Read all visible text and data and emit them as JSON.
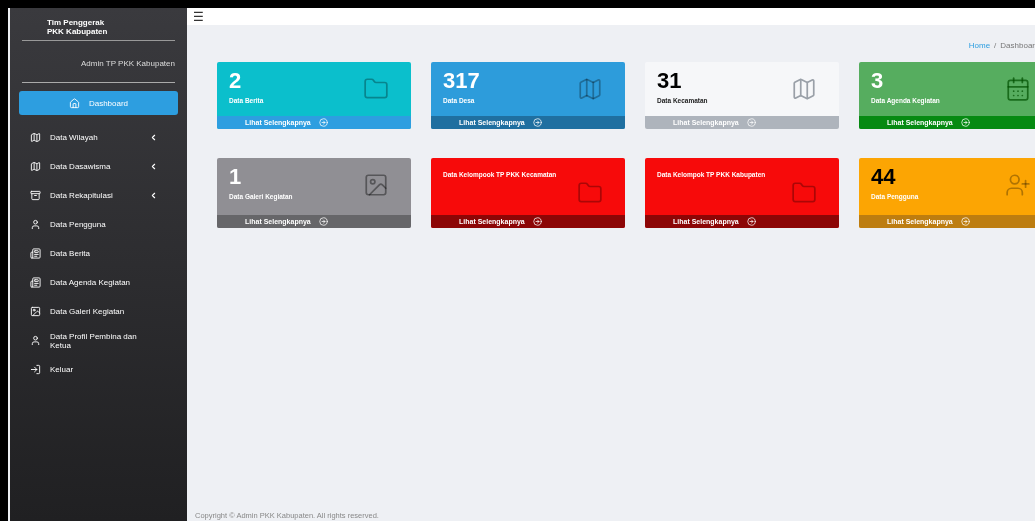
{
  "sidebar": {
    "brand": [
      "Tim Penggerak",
      "PKK Kabupaten"
    ],
    "user": "Admin TP PKK Kabupaten",
    "items": [
      {
        "label": "Dashboard",
        "selected": true,
        "submenu": false
      },
      {
        "label": "Data Wilayah",
        "selected": false,
        "submenu": true
      },
      {
        "label": "Data Dasawisma",
        "selected": false,
        "submenu": true
      },
      {
        "label": "Data Rekapitulasi",
        "selected": false,
        "submenu": true
      },
      {
        "label": "Data Pengguna",
        "selected": false,
        "submenu": false
      },
      {
        "label": "Data Berita",
        "selected": false,
        "submenu": false
      },
      {
        "label": "Data Agenda Kegiatan",
        "selected": false,
        "submenu": false
      },
      {
        "label": "Data Galeri Kegiatan",
        "selected": false,
        "submenu": false
      },
      {
        "label": "Data Profil Pembina dan Ketua",
        "selected": false,
        "submenu": false
      },
      {
        "label": "Keluar",
        "selected": false,
        "submenu": false
      }
    ]
  },
  "menu_icon": "☰",
  "breadcrumb": [
    {
      "label": "Home",
      "kind": "link"
    },
    {
      "label": "/",
      "kind": "separator"
    },
    {
      "label": "Dashboar",
      "kind": "current"
    }
  ],
  "cards": [
    {
      "kind": "count",
      "value": "2",
      "label": "Data Berita",
      "color": "#0bbfcc",
      "link": "Lihat Selengkapnya"
    },
    {
      "kind": "count",
      "value": "317",
      "label": "Data Desa",
      "color": "#2d9cdb",
      "link": "Lihat Selengkapnya"
    },
    {
      "kind": "count",
      "value": "31",
      "label": "Data Kecamatan",
      "color": "#f6f7f9",
      "link": "Lihat Selengkapnya"
    },
    {
      "kind": "count",
      "value": "3",
      "label": "Data Agenda Kegiatan",
      "color": "#56ad5f",
      "link": "Lihat Selengkapnya"
    },
    {
      "kind": "count",
      "value": "1",
      "label": "Data Galeri Kegiatan",
      "color": "#908f94",
      "link": "Lihat Selengkapnya"
    },
    {
      "kind": "title",
      "label": "Data Kelompook TP PKK Kecamatan",
      "color": "#f70a0a",
      "link": "Lihat Selengkapnya"
    },
    {
      "kind": "title",
      "label": "Data Kelompok TP PKK Kabupaten",
      "color": "#f70a0a",
      "link": "Lihat Selengkapnya"
    },
    {
      "kind": "count",
      "value": "44",
      "label": "Data Pengguna",
      "color": "#fca503",
      "link": "Lihat Selengkapnya"
    }
  ],
  "footer": "Copyright © Admin PKK Kabupaten. All rights reserved."
}
